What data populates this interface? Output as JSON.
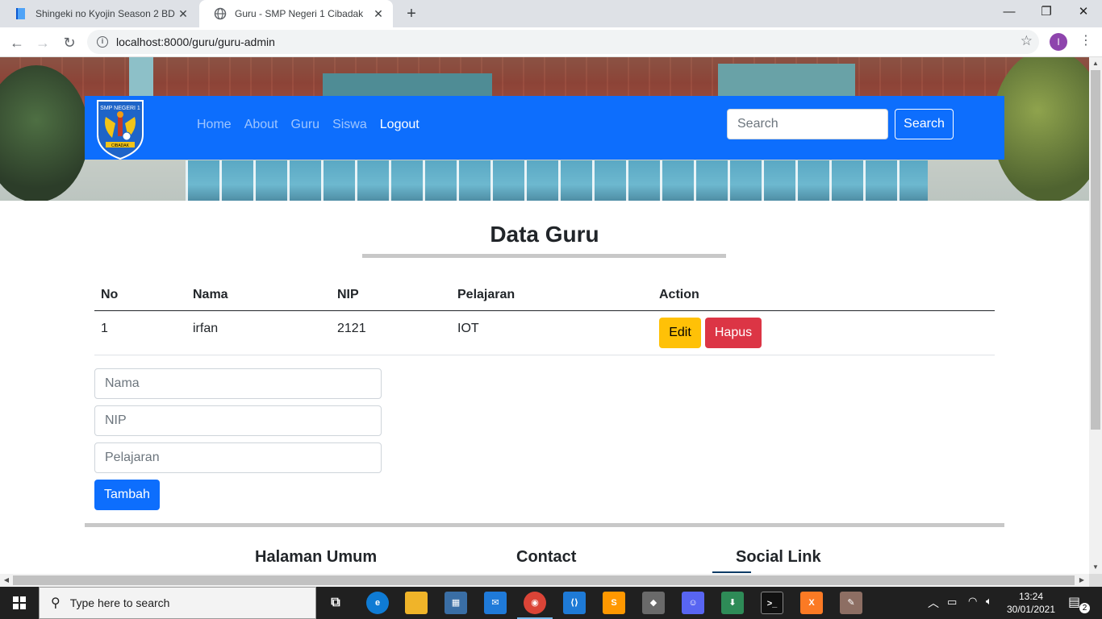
{
  "browser": {
    "tabs": [
      {
        "title": "Shingeki no Kyojin Season 2 BD (",
        "active": false
      },
      {
        "title": "Guru - SMP Negeri 1 Cibadak",
        "active": true
      }
    ],
    "url": "localhost:8000/guru/guru-admin",
    "profile_initial": "I"
  },
  "navbar": {
    "links": [
      "Home",
      "About",
      "Guru",
      "Siswa",
      "Logout"
    ],
    "active_link": "Logout",
    "search_placeholder": "Search",
    "search_button": "Search",
    "logo_text": "SMP NEGERI 1",
    "logo_banner": "CIBADAK"
  },
  "page": {
    "title": "Data Guru"
  },
  "table": {
    "headers": [
      "No",
      "Nama",
      "NIP",
      "Pelajaran",
      "Action"
    ],
    "rows": [
      {
        "no": "1",
        "nama": "irfan",
        "nip": "2121",
        "pelajaran": "IOT",
        "edit_label": "Edit",
        "delete_label": "Hapus"
      }
    ]
  },
  "form": {
    "nama_placeholder": "Nama",
    "nip_placeholder": "NIP",
    "pelajaran_placeholder": "Pelajaran",
    "submit_label": "Tambah"
  },
  "footer": {
    "columns": [
      "Halaman Umum",
      "Contact",
      "Social Link"
    ]
  },
  "taskbar": {
    "search_placeholder": "Type here to search",
    "time": "13:24",
    "date": "30/01/2021",
    "notifications": "2"
  },
  "colors": {
    "primary": "#0d6efd",
    "warning": "#ffc107",
    "danger": "#dc3545"
  }
}
